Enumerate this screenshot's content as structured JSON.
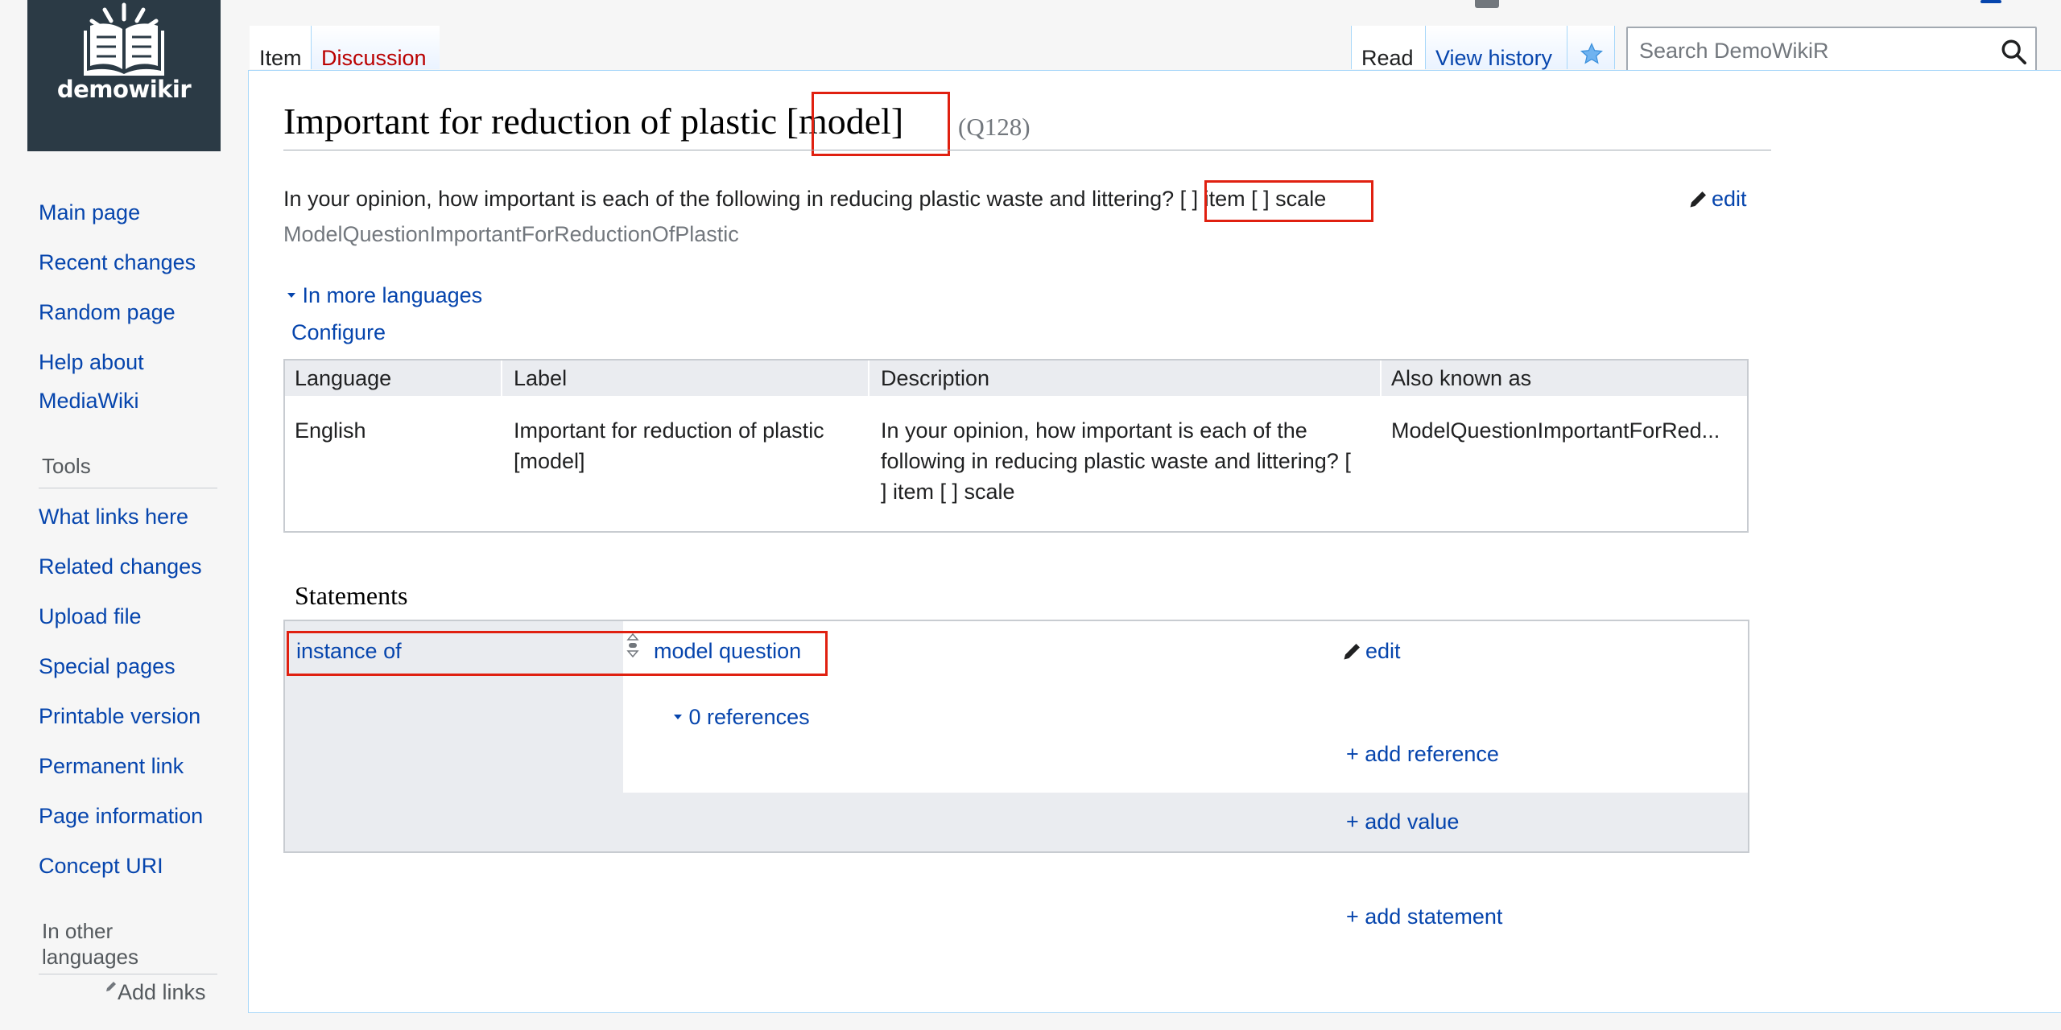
{
  "site": {
    "logo_text": "demowikir"
  },
  "nav": {
    "main_page": "Main page",
    "recent_changes": "Recent changes",
    "random_page": "Random page",
    "help_line1": "Help about",
    "help_line2": "MediaWiki",
    "tools_heading": "Tools",
    "what_links_here": "What links here",
    "related_changes": "Related changes",
    "upload_file": "Upload file",
    "special_pages": "Special pages",
    "printable_version": "Printable version",
    "permanent_link": "Permanent link",
    "page_information": "Page information",
    "concept_uri": "Concept URI",
    "other_lang_line1": "In other",
    "other_lang_line2": "languages",
    "add_links": "Add links"
  },
  "tabs": {
    "item": "Item",
    "discussion": "Discussion",
    "read": "Read",
    "view_history": "View history"
  },
  "search": {
    "placeholder": "Search DemoWikiR"
  },
  "page": {
    "title_main": "Important for reduction of plastic",
    "title_tag": "[model]",
    "qid": "(Q128)",
    "description_main": "In your opinion, how important is each of the following in reducing plastic waste and littering?",
    "description_tag": "[ ] item [ ] scale",
    "alias": "ModelQuestionImportantForReductionOfPlastic",
    "edit_label": "edit",
    "in_more_languages": "In more languages",
    "configure": "Configure"
  },
  "lang_table": {
    "headers": [
      "Language",
      "Label",
      "Description",
      "Also known as"
    ],
    "row": {
      "language": "English",
      "label_line1": "Important for reduction of plastic",
      "label_line2": "[model]",
      "desc_line1": "In your opinion, how important is each of the",
      "desc_line2": "following in reducing plastic waste and littering? [",
      "desc_line3": "] item [ ] scale",
      "aka": "ModelQuestionImportantForRed..."
    }
  },
  "statements": {
    "heading": "Statements",
    "property": "instance of",
    "value": "model question",
    "edit_label": "edit",
    "references": "0 references",
    "add_reference": "+ add reference",
    "add_value": "+ add value",
    "add_statement": "+ add statement"
  },
  "colors": {
    "link": "#0645ad",
    "red_link": "#ba0000",
    "highlight": "#e02010",
    "panel_bg": "#2b3a45"
  }
}
